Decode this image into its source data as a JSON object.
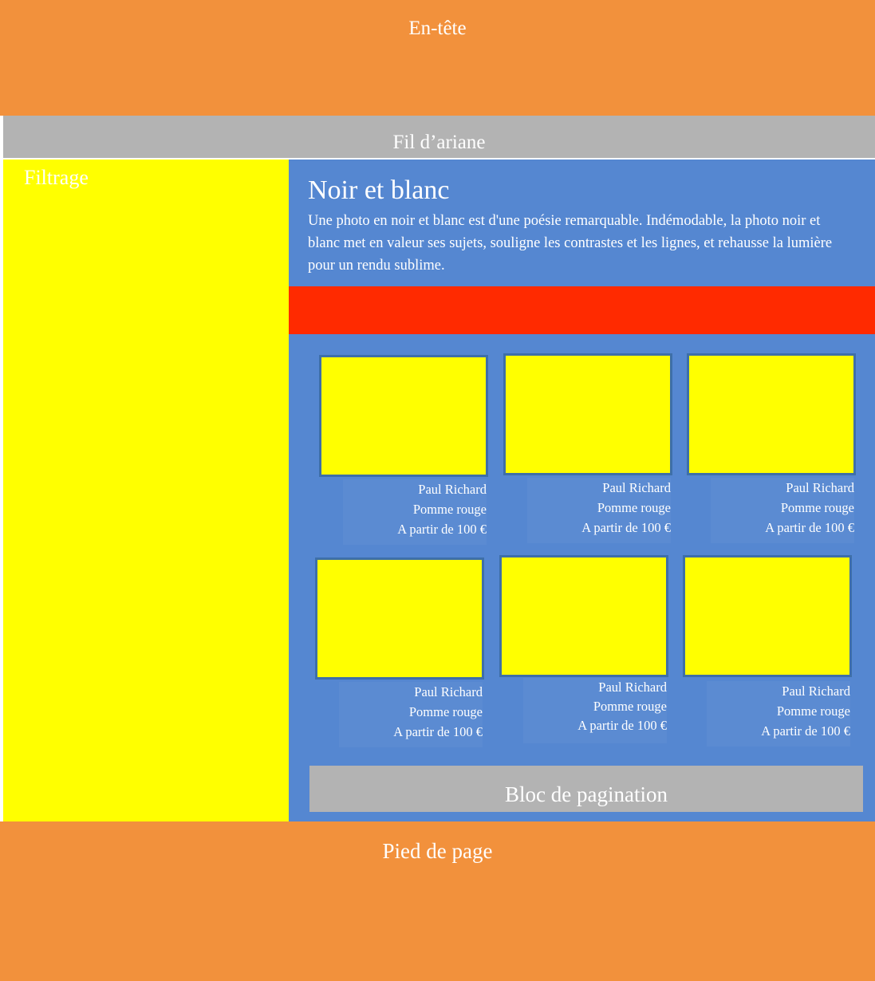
{
  "colors": {
    "orange": "#f2913c",
    "gray": "#b3b3b3",
    "yellow": "#ffff00",
    "blue": "#5587d1",
    "red": "#ff2a00"
  },
  "header": {
    "label": "En-tête"
  },
  "breadcrumb": {
    "label": "Fil d’ariane"
  },
  "sidebar": {
    "label": "Filtrage"
  },
  "content": {
    "title": "Noir et blanc",
    "description": "Une photo en noir et blanc est d'une poésie remarquable. Indémodable, la photo noir et blanc met en valeur ses sujets, souligne les contrastes et les lignes, et rehausse la lumière pour un rendu sublime."
  },
  "products": [
    {
      "artist": "Paul Richard",
      "title": "Pomme rouge",
      "price": "A partir de 100 €"
    },
    {
      "artist": "Paul Richard",
      "title": "Pomme rouge",
      "price": "A partir de 100 €"
    },
    {
      "artist": "Paul Richard",
      "title": "Pomme rouge",
      "price": "A partir de 100 €"
    },
    {
      "artist": "Paul Richard",
      "title": "Pomme rouge",
      "price": "A partir de 100 €"
    },
    {
      "artist": "Paul Richard",
      "title": "Pomme rouge",
      "price": "A partir de 100 €"
    },
    {
      "artist": "Paul Richard",
      "title": "Pomme rouge",
      "price": "A partir de 100 €"
    }
  ],
  "pagination": {
    "label": "Bloc de pagination"
  },
  "footer": {
    "label": "Pied de page"
  }
}
